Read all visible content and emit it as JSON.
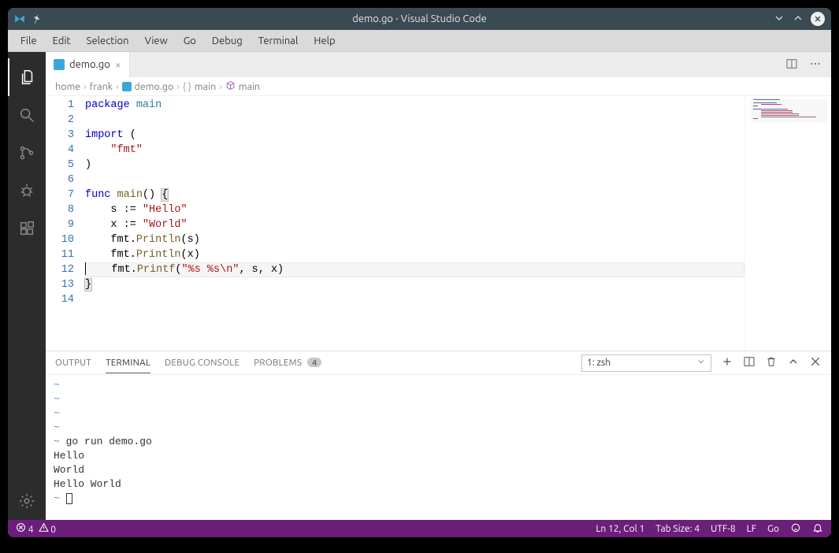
{
  "window": {
    "title": "demo.go - Visual Studio Code"
  },
  "menu": {
    "items": [
      "File",
      "Edit",
      "Selection",
      "View",
      "Go",
      "Debug",
      "Terminal",
      "Help"
    ]
  },
  "activitybar": {
    "icons": [
      "files-icon",
      "search-icon",
      "source-control-icon",
      "debug-icon",
      "extensions-icon"
    ],
    "bottom_icon": "gear-icon"
  },
  "tabs": {
    "open": [
      {
        "label": "demo.go"
      }
    ]
  },
  "breadcrumb": {
    "parts": [
      {
        "label": "home",
        "icon": null
      },
      {
        "label": "frank",
        "icon": null
      },
      {
        "label": "demo.go",
        "icon": "go-file-icon"
      },
      {
        "label": "main",
        "icon": "braces-icon"
      },
      {
        "label": "main",
        "icon": "cube-icon"
      }
    ]
  },
  "editor": {
    "line_count": 14,
    "current_line": 12,
    "lines": [
      {
        "n": 1,
        "tokens": [
          [
            "kw",
            "package"
          ],
          [
            "sp",
            " "
          ],
          [
            "pkg",
            "main"
          ]
        ]
      },
      {
        "n": 2,
        "tokens": []
      },
      {
        "n": 3,
        "tokens": [
          [
            "kw",
            "import"
          ],
          [
            "sp",
            " ("
          ]
        ]
      },
      {
        "n": 4,
        "tokens": [
          [
            "sp",
            "    "
          ],
          [
            "str",
            "\"fmt\""
          ]
        ]
      },
      {
        "n": 5,
        "tokens": [
          [
            "sp",
            ")"
          ]
        ]
      },
      {
        "n": 6,
        "tokens": []
      },
      {
        "n": 7,
        "tokens": [
          [
            "kw",
            "func"
          ],
          [
            "sp",
            " "
          ],
          [
            "funcdef",
            "main"
          ],
          [
            "sp",
            "() "
          ],
          [
            "hl",
            "{"
          ]
        ]
      },
      {
        "n": 8,
        "tokens": [
          [
            "sp",
            "    s := "
          ],
          [
            "str",
            "\"Hello\""
          ]
        ]
      },
      {
        "n": 9,
        "tokens": [
          [
            "sp",
            "    x := "
          ],
          [
            "str",
            "\"World\""
          ]
        ]
      },
      {
        "n": 10,
        "tokens": [
          [
            "sp",
            "    fmt."
          ],
          [
            "func",
            "Println"
          ],
          [
            "sp",
            "(s)"
          ]
        ]
      },
      {
        "n": 11,
        "tokens": [
          [
            "sp",
            "    fmt."
          ],
          [
            "func",
            "Println"
          ],
          [
            "sp",
            "(x)"
          ]
        ]
      },
      {
        "n": 12,
        "tokens": [
          [
            "cursor",
            ""
          ],
          [
            "sp",
            "    fmt."
          ],
          [
            "func",
            "Printf"
          ],
          [
            "sp",
            "("
          ],
          [
            "str",
            "\"%s %s"
          ],
          [
            "esc",
            "\\n"
          ],
          [
            "str",
            "\""
          ],
          [
            "sp",
            ", s, x)"
          ]
        ]
      },
      {
        "n": 13,
        "tokens": [
          [
            "hl",
            "}"
          ]
        ]
      },
      {
        "n": 14,
        "tokens": []
      }
    ]
  },
  "panel": {
    "tabs": {
      "output": "OUTPUT",
      "terminal": "TERMINAL",
      "debug_console": "DEBUG CONSOLE",
      "problems": "PROBLEMS",
      "problems_badge": "4"
    },
    "terminal_selector": "1: zsh",
    "terminal_output": "~\n~\n~\n~\n~ go run demo.go\nHello\nWorld\nHello World\n~ "
  },
  "statusbar": {
    "errors": "4",
    "warnings": "0",
    "cursor": "Ln 12, Col 1",
    "tab_size": "Tab Size: 4",
    "encoding": "UTF-8",
    "eol": "LF",
    "language": "Go"
  }
}
